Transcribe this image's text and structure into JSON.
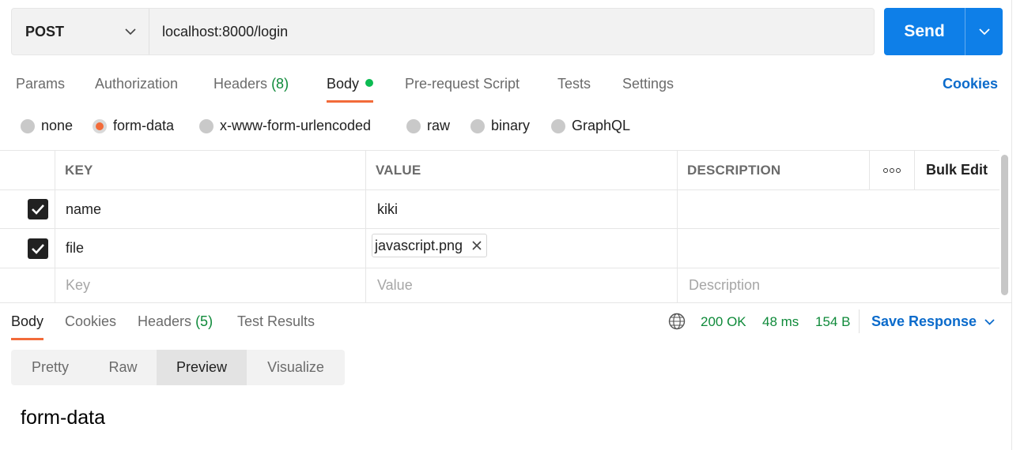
{
  "request": {
    "method": "POST",
    "url": "localhost:8000/login",
    "send_label": "Send"
  },
  "request_tabs": [
    {
      "label": "Params",
      "count": ""
    },
    {
      "label": "Authorization",
      "count": ""
    },
    {
      "label": "Headers",
      "count": "(8)"
    },
    {
      "label": "Body",
      "count": "",
      "active": true,
      "indicator": "green-dot"
    },
    {
      "label": "Pre-request Script",
      "count": ""
    },
    {
      "label": "Tests",
      "count": ""
    },
    {
      "label": "Settings",
      "count": ""
    }
  ],
  "cookies_link": "Cookies",
  "body_types": [
    {
      "label": "none",
      "selected": false
    },
    {
      "label": "form-data",
      "selected": true
    },
    {
      "label": "x-www-form-urlencoded",
      "selected": false
    },
    {
      "label": "raw",
      "selected": false
    },
    {
      "label": "binary",
      "selected": false
    },
    {
      "label": "GraphQL",
      "selected": false
    }
  ],
  "params_table": {
    "headers": {
      "key": "KEY",
      "value": "VALUE",
      "description": "DESCRIPTION",
      "more_icon": "more-dots-icon",
      "bulk_edit": "Bulk Edit"
    },
    "rows": [
      {
        "checked": true,
        "key": "name",
        "value": "kiki",
        "description": ""
      },
      {
        "checked": true,
        "key": "file",
        "value": "javascript.png",
        "value_type": "file",
        "description": ""
      }
    ],
    "placeholders": {
      "key": "Key",
      "value": "Value",
      "description": "Description"
    }
  },
  "response": {
    "tabs": [
      {
        "label": "Body",
        "count": "",
        "active": true
      },
      {
        "label": "Cookies",
        "count": ""
      },
      {
        "label": "Headers",
        "count": "(5)"
      },
      {
        "label": "Test Results",
        "count": ""
      }
    ],
    "status": "200 OK",
    "time": "48 ms",
    "size": "154 B",
    "save_response": "Save Response",
    "view_tabs": [
      {
        "label": "Pretty",
        "active": false
      },
      {
        "label": "Raw",
        "active": false
      },
      {
        "label": "Preview",
        "active": true
      },
      {
        "label": "Visualize",
        "active": false
      }
    ],
    "preview_content": "form-data"
  },
  "colors": {
    "accent_orange": "#f26b3a",
    "send_blue": "#0e7fe8",
    "link_blue": "#0b6bcb",
    "status_green": "#0f8a3a",
    "dot_green": "#0cbb52"
  }
}
